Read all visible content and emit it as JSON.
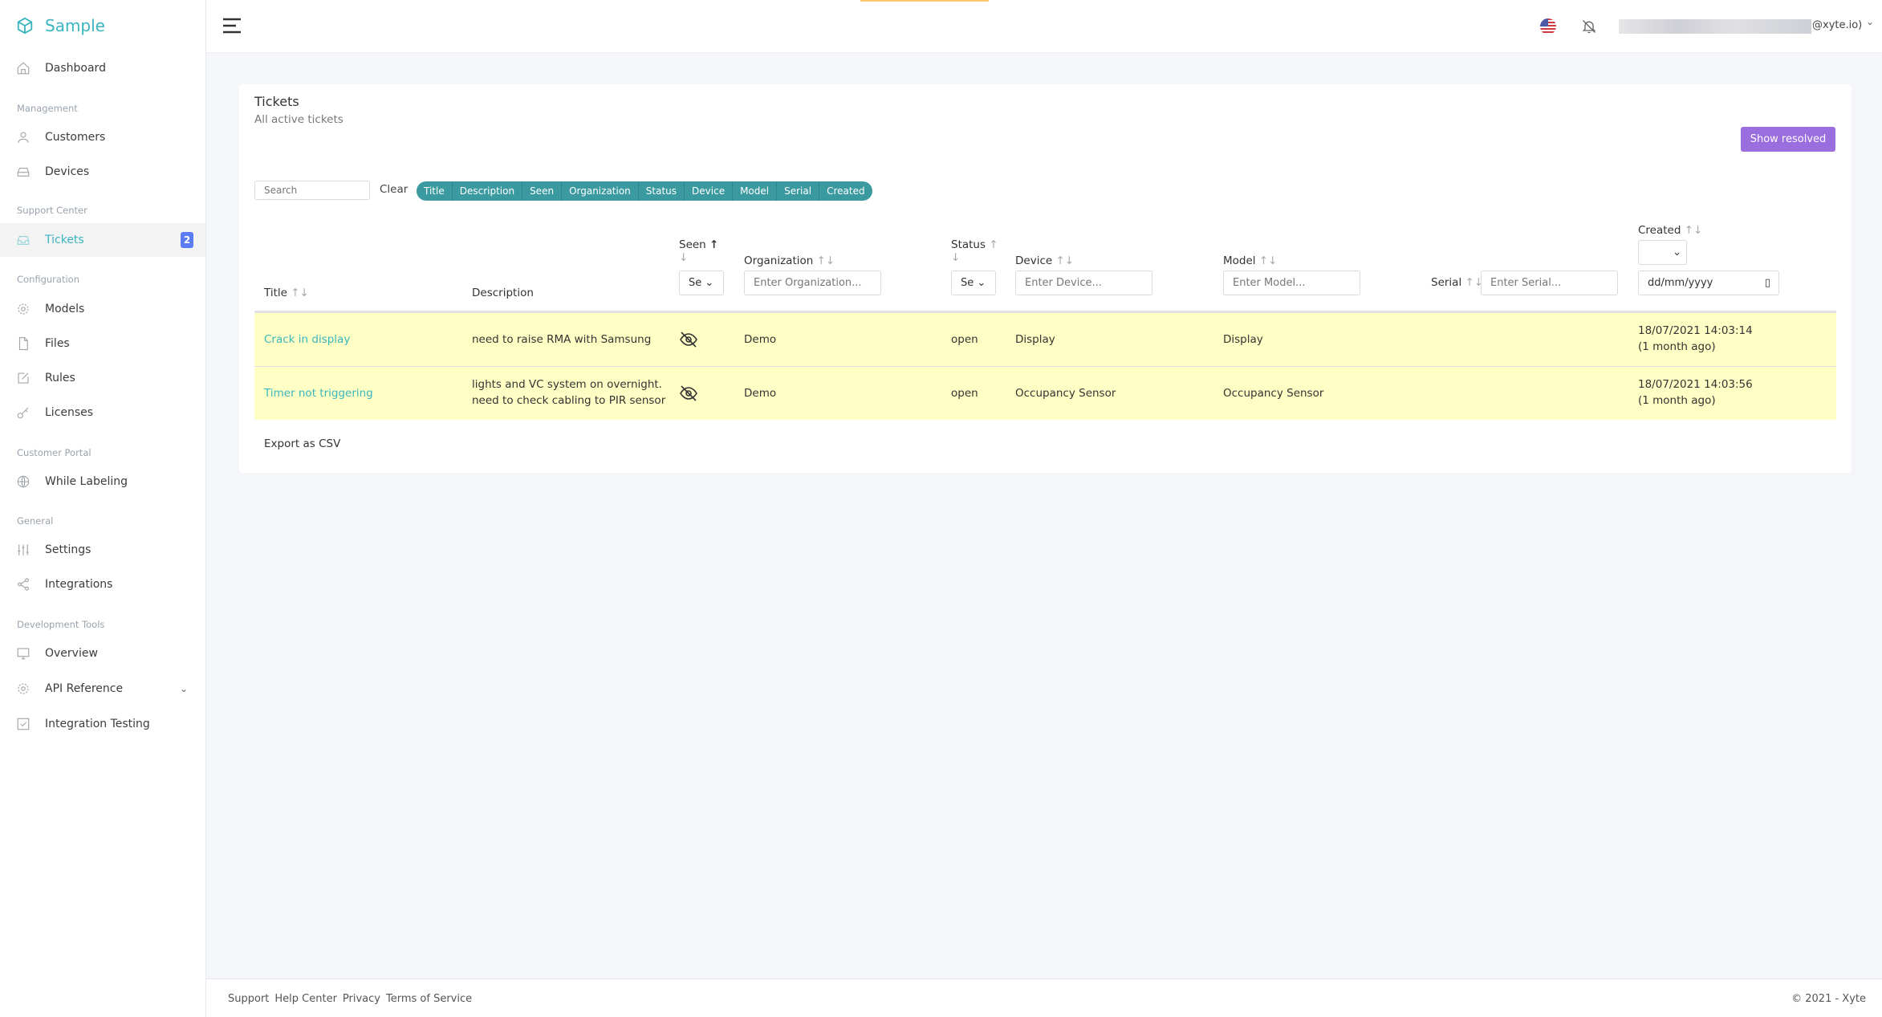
{
  "brand": {
    "name": "Sample",
    "color": "#3bb5bf"
  },
  "sidebar": {
    "dashboard": "Dashboard",
    "sections": [
      "Management",
      "Support Center",
      "Configuration",
      "Customer Portal",
      "General",
      "Development Tools"
    ],
    "items": [
      {
        "label": "Customers",
        "icon": "user-icon"
      },
      {
        "label": "Devices",
        "icon": "device-icon"
      },
      {
        "label": "Tickets",
        "icon": "inbox-icon",
        "badge": "2",
        "active": true
      },
      {
        "label": "Models",
        "icon": "gear-icon"
      },
      {
        "label": "Files",
        "icon": "file-icon"
      },
      {
        "label": "Rules",
        "icon": "edit-icon"
      },
      {
        "label": "Licenses",
        "icon": "key-icon"
      },
      {
        "label": "While Labeling",
        "icon": "globe-icon"
      },
      {
        "label": "Settings",
        "icon": "sliders-icon"
      },
      {
        "label": "Integrations",
        "icon": "share-icon"
      },
      {
        "label": "Overview",
        "icon": "monitor-icon"
      },
      {
        "label": "API Reference",
        "icon": "gear-icon"
      },
      {
        "label": "Integration Testing",
        "icon": "checkbox-icon"
      }
    ]
  },
  "topbar": {
    "user_suffix": "@xyte.io)"
  },
  "card": {
    "title": "Tickets",
    "subtitle": "All active tickets",
    "show_resolved": "Show resolved",
    "search_placeholder": "Search",
    "clear": "Clear",
    "columns_toggle": [
      "Title",
      "Description",
      "Seen",
      "Organization",
      "Status",
      "Device",
      "Model",
      "Serial",
      "Created"
    ]
  },
  "table": {
    "headers": {
      "title": "Title",
      "description": "Description",
      "seen": "Seen",
      "organization": "Organization",
      "status": "Status",
      "device": "Device",
      "model": "Model",
      "serial": "Serial",
      "created": "Created"
    },
    "filters": {
      "seen_select": "Se",
      "status_select": "Se",
      "organization": "Enter Organization...",
      "device": "Enter Device...",
      "model": "Enter Model...",
      "serial": "Enter Serial...",
      "created_date": "dd/mm/yyyy"
    },
    "rows": [
      {
        "title": "Crack in display",
        "description1": "need to raise RMA with Samsung",
        "description2": "",
        "organization": "Demo",
        "status": "open",
        "device": "Display",
        "model": "Display",
        "serial": "",
        "created": "18/07/2021 14:03:14",
        "created_ago": "(1 month ago)"
      },
      {
        "title": "Timer not triggering",
        "description1": "lights and VC system on overnight.",
        "description2": "need to check cabling to PIR sensor",
        "organization": "Demo",
        "status": "open",
        "device": "Occupancy Sensor",
        "model": "Occupancy Sensor",
        "serial": "",
        "created": "18/07/2021 14:03:56",
        "created_ago": "(1 month ago)"
      }
    ],
    "export": "Export as CSV",
    "row_color": "#ffffc5"
  },
  "footer": {
    "links": [
      "Support",
      "Help Center",
      "Privacy",
      "Terms of Service"
    ],
    "copyright": "© 2021 - Xyte"
  }
}
